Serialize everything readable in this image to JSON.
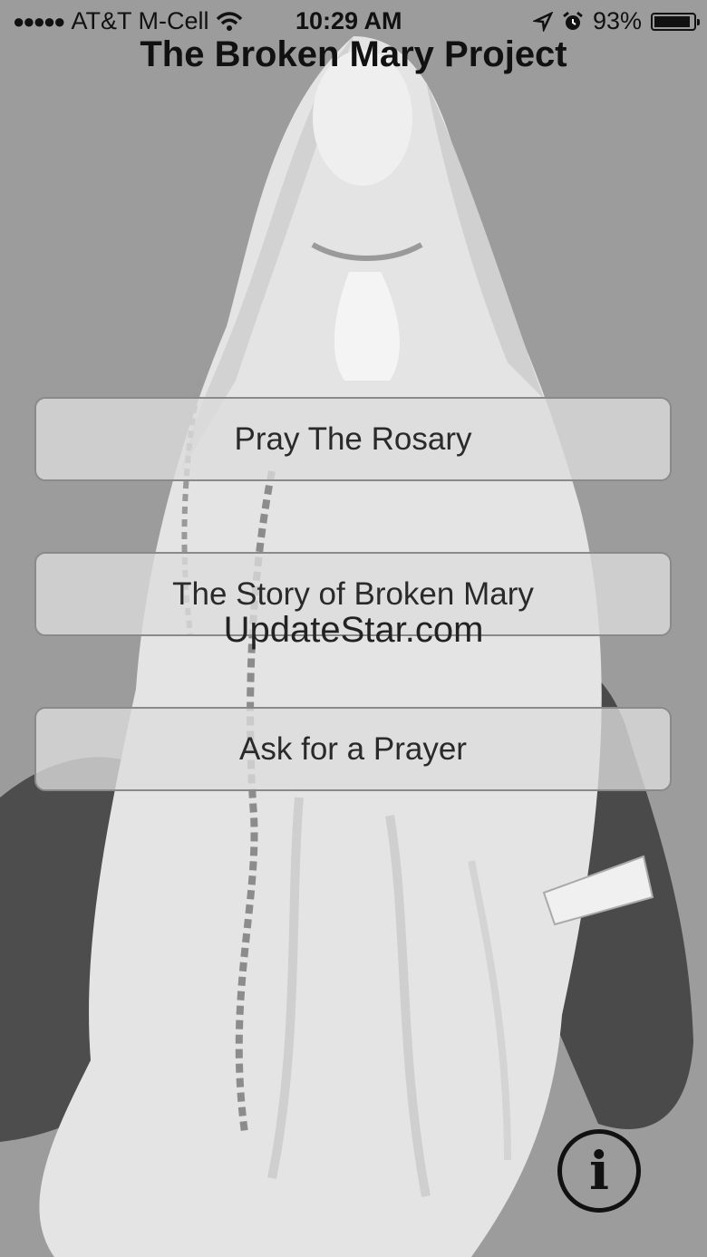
{
  "status_bar": {
    "signal_dots": "●●●●●",
    "carrier": "AT&T M-Cell",
    "time": "10:29 AM",
    "battery_percent_label": "93%",
    "battery_level": 0.93,
    "icons": [
      "signal-dots-icon",
      "wifi-icon",
      "location-arrow-icon",
      "alarm-clock-icon",
      "battery-icon"
    ]
  },
  "app": {
    "title": "The Broken Mary Project"
  },
  "menu": {
    "buttons": [
      {
        "label": "Pray The Rosary"
      },
      {
        "label": "The Story of Broken Mary"
      },
      {
        "label": "Ask for a Prayer"
      }
    ]
  },
  "watermark": "UpdateStar.com",
  "info_button": {
    "glyph": "i",
    "icon": "info-icon"
  },
  "colors": {
    "background": "#9c9c9c",
    "statue": "#e6e6e6",
    "hands": "#4a4a4a",
    "text": "#111111"
  }
}
